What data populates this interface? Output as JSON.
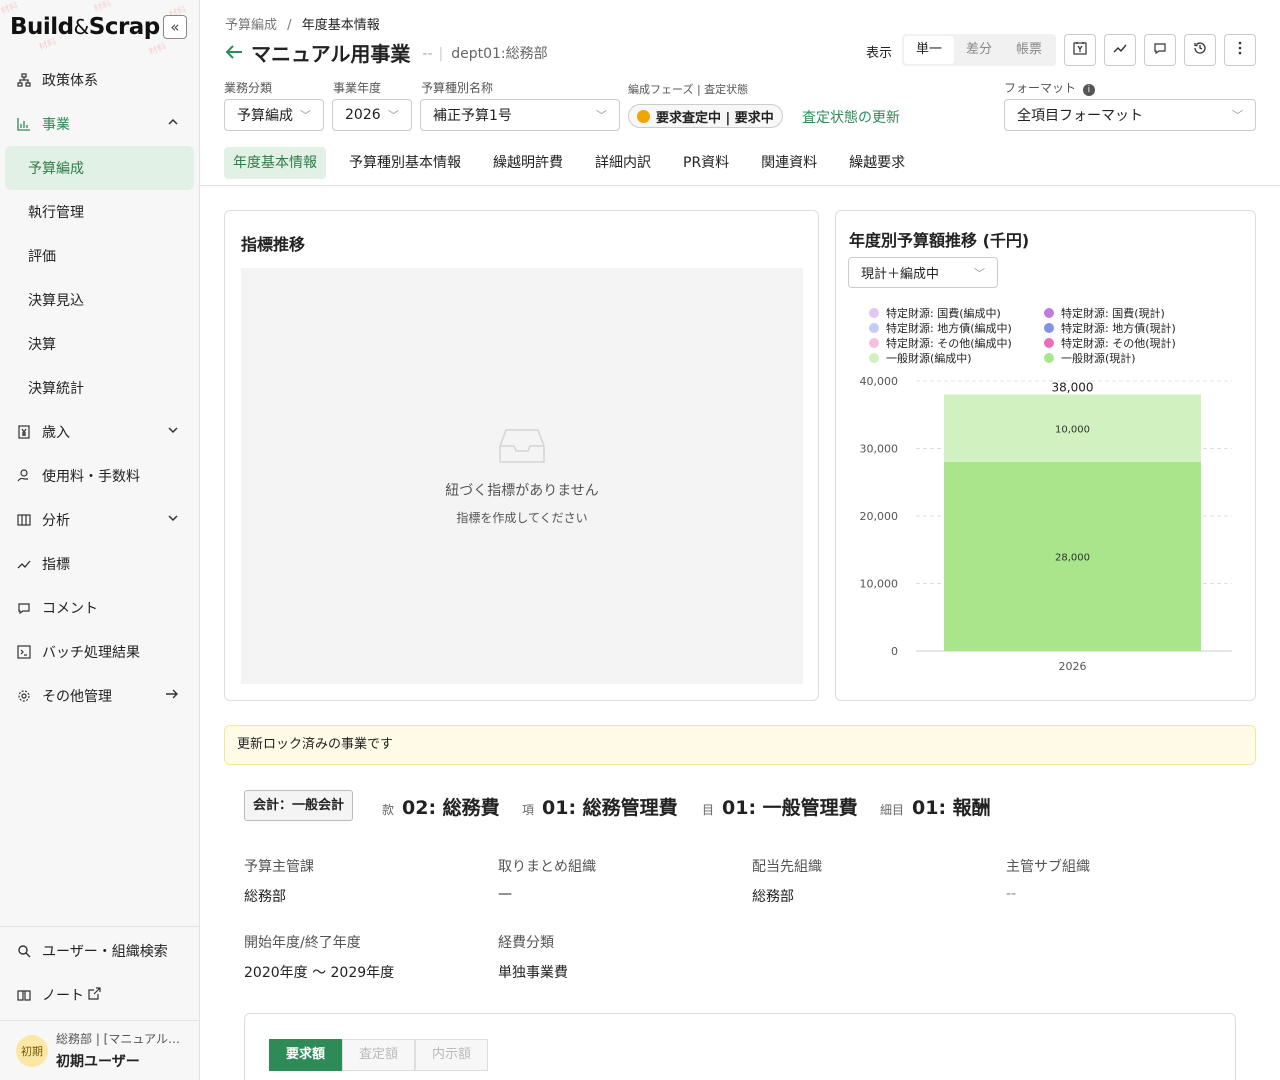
{
  "app": {
    "logo_left": "Build",
    "logo_amp": "&",
    "logo_right": "Scrap",
    "collapse_icon": "«"
  },
  "sidebar": {
    "items": [
      {
        "label": "政策体系",
        "icon": "hierarchy-icon"
      },
      {
        "label": "事業",
        "icon": "bar-chart-icon",
        "expanded": true
      },
      {
        "label": "歳入",
        "icon": "yen-doc-icon"
      },
      {
        "label": "使用料・手数料",
        "icon": "hand-coin-icon"
      },
      {
        "label": "分析",
        "icon": "board-icon"
      },
      {
        "label": "指標",
        "icon": "trend-icon"
      },
      {
        "label": "コメント",
        "icon": "chat-icon"
      },
      {
        "label": "バッチ処理結果",
        "icon": "terminal-icon"
      },
      {
        "label": "その他管理",
        "icon": "gear-icon"
      }
    ],
    "sub_items": [
      "予算編成",
      "執行管理",
      "評価",
      "決算見込",
      "決算",
      "決算統計"
    ],
    "bottom": {
      "search": "ユーザー・組織検索",
      "note": "ノート"
    },
    "user": {
      "avatar": "初期",
      "org": "総務部 | [マニュアル…",
      "name": "初期ユーザー"
    }
  },
  "header": {
    "breadcrumb": {
      "parent": "予算編成",
      "sep": "/",
      "current": "年度基本情報"
    },
    "title": "マニュアル用事業",
    "dash": "--",
    "dept": "dept01:総務部",
    "view_label": "表示",
    "view_modes": [
      "単一",
      "差分",
      "帳票"
    ]
  },
  "filters": {
    "business_type": {
      "label": "業務分類",
      "value": "予算編成"
    },
    "fiscal_year": {
      "label": "事業年度",
      "value": "2026"
    },
    "budget_type": {
      "label": "予算種別名称",
      "value": "補正予算1号"
    },
    "phase": {
      "label": "編成フェーズ | 査定状態",
      "value": "要求査定中 | 要求中",
      "color": "#f0a500"
    },
    "update_link": "査定状態の更新",
    "format": {
      "label": "フォーマット",
      "value": "全項目フォーマット"
    }
  },
  "tabs": [
    "年度基本情報",
    "予算種別基本情報",
    "繰越明許費",
    "詳細内訳",
    "PR資料",
    "関連資料",
    "繰越要求"
  ],
  "indicators": {
    "title": "指標推移",
    "empty_title": "紐づく指標がありません",
    "empty_sub": "指標を作成してください"
  },
  "budget_chart": {
    "title": "年度別予算額推移 (千円)",
    "select": "現計＋編成中"
  },
  "chart_data": {
    "type": "bar",
    "title": "年度別予算額推移 (千円)",
    "categories": [
      "2026"
    ],
    "ylim": [
      0,
      40000
    ],
    "yticks": [
      "0",
      "10,000",
      "20,000",
      "30,000",
      "40,000"
    ],
    "legend": [
      {
        "name": "特定財源: 国費(編成中)",
        "color": "#e3c6f2"
      },
      {
        "name": "特定財源: 国費(現計)",
        "color": "#c07be0"
      },
      {
        "name": "特定財源: 地方債(編成中)",
        "color": "#c3cdf2"
      },
      {
        "name": "特定財源: 地方債(現計)",
        "color": "#8093e6"
      },
      {
        "name": "特定財源: その他(編成中)",
        "color": "#f5bfe0"
      },
      {
        "name": "特定財源: その他(現計)",
        "color": "#ec6eb4"
      },
      {
        "name": "一般財源(編成中)",
        "color": "#d2f1c0"
      },
      {
        "name": "一般財源(現計)",
        "color": "#a8e58b"
      }
    ],
    "series": [
      {
        "name": "一般財源(現計)",
        "values": [
          28000
        ],
        "label": "28,000",
        "color": "#a8e58b"
      },
      {
        "name": "一般財源(編成中)",
        "values": [
          10000
        ],
        "label": "10,000",
        "color": "#d2f1c0"
      }
    ],
    "total_label": "38,000"
  },
  "notice": "更新ロック済みの事業です",
  "account": {
    "kaikei": "会計：一般会計",
    "kan": {
      "k": "款",
      "v": "02: 総務費"
    },
    "kou": {
      "k": "項",
      "v": "01: 総務管理費"
    },
    "moku": {
      "k": "目",
      "v": "01: 一般管理費"
    },
    "saimoku": {
      "k": "細目",
      "v": "01: 報酬"
    }
  },
  "info": {
    "budget_dept_label": "予算主管課",
    "budget_dept": "総務部",
    "collect_label": "取りまとめ組織",
    "collect": "—",
    "alloc_label": "配当先組織",
    "alloc": "総務部",
    "sub_label": "主管サブ組織",
    "sub": "--",
    "period_label": "開始年度/終了年度",
    "period": "2020年度 〜 2029年度",
    "expense_label": "経費分類",
    "expense": "単独事業費"
  },
  "amount_tabs": [
    "要求額",
    "査定額",
    "内示額"
  ]
}
